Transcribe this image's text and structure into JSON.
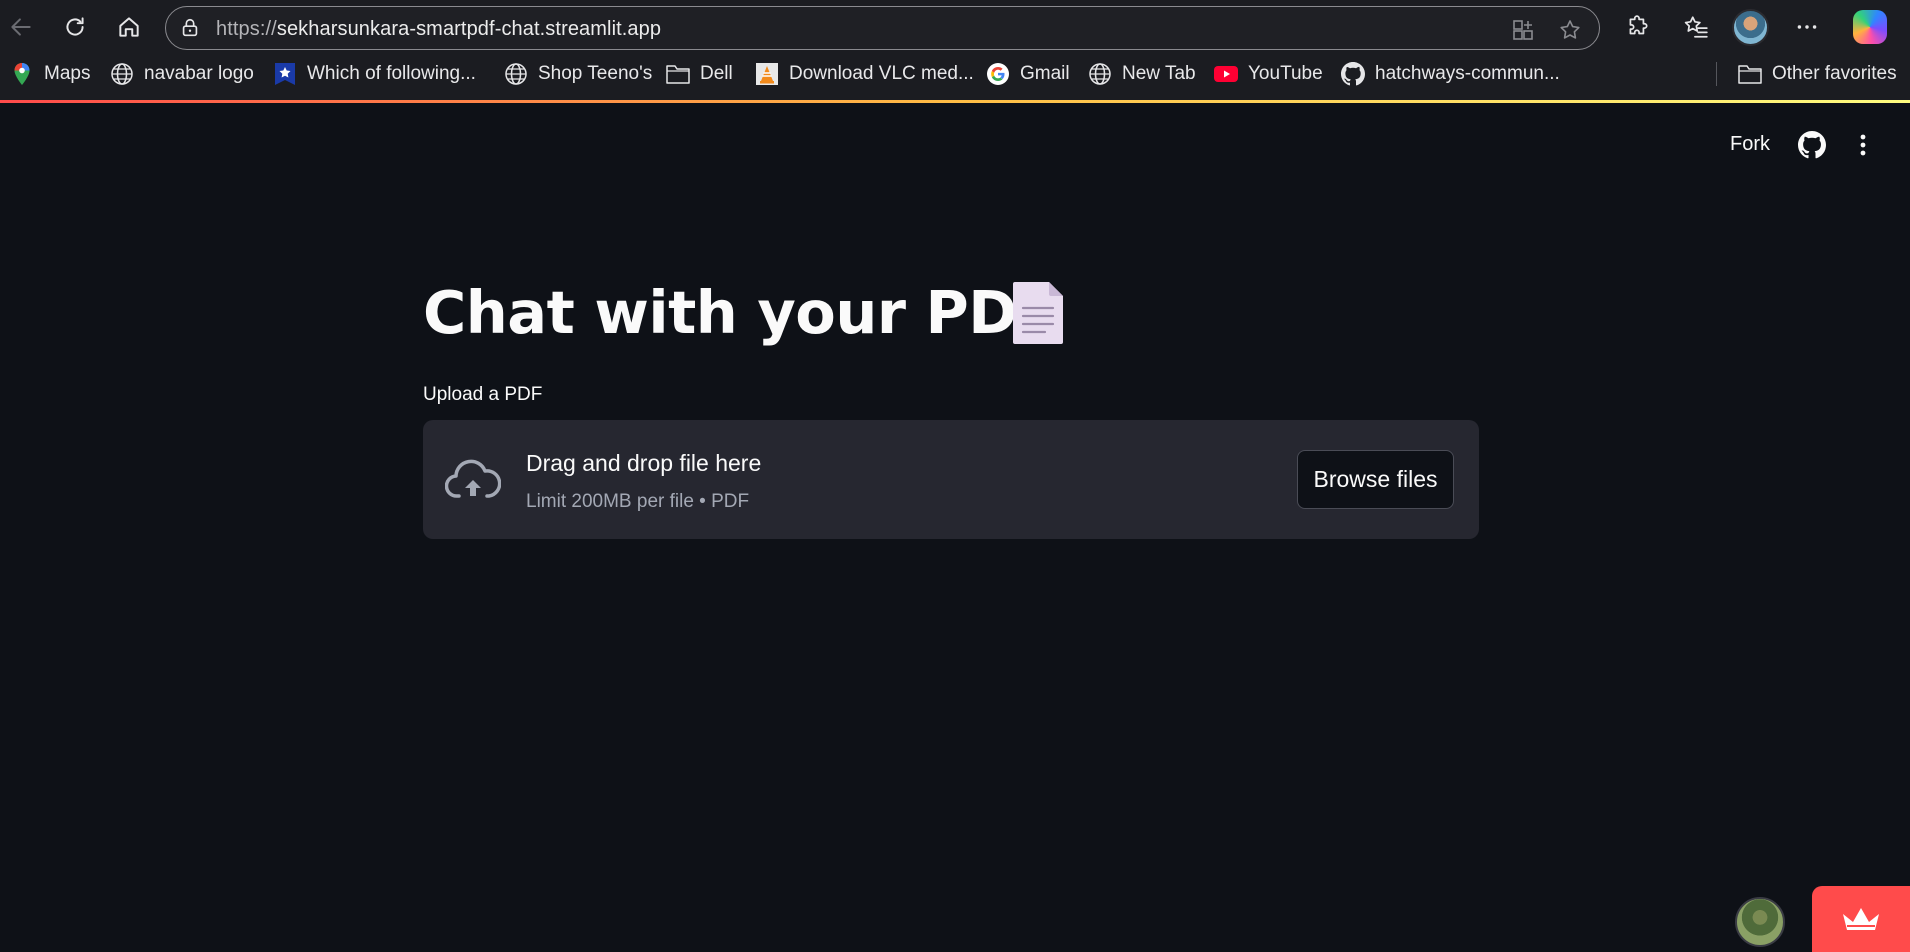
{
  "browser": {
    "url_scheme": "https://",
    "url_host": "sekharsunkara-smartpdf-chat.streamlit.app",
    "bookmarks": [
      {
        "label": "Maps",
        "icon": "maps-pin-icon"
      },
      {
        "label": "navabar logo",
        "icon": "globe-icon"
      },
      {
        "label": "Which of following...",
        "icon": "star-badge-icon"
      },
      {
        "label": "Shop Teeno's",
        "icon": "globe-icon"
      },
      {
        "label": "Dell",
        "icon": "folder-icon"
      },
      {
        "label": "Download VLC med...",
        "icon": "vlc-icon"
      },
      {
        "label": "Gmail",
        "icon": "google-icon"
      },
      {
        "label": "New Tab",
        "icon": "globe-icon"
      },
      {
        "label": "YouTube",
        "icon": "youtube-icon"
      },
      {
        "label": "hatchways-commun...",
        "icon": "github-icon"
      }
    ],
    "other_favorites": "Other favorites"
  },
  "header": {
    "fork_label": "Fork"
  },
  "main": {
    "title": "Chat with your PDF",
    "title_emoji": "document-emoji",
    "upload_label": "Upload a PDF",
    "dropzone_title": "Drag and drop file here",
    "dropzone_subtitle": "Limit 200MB per file • PDF",
    "browse_label": "Browse files"
  },
  "colors": {
    "background": "#0e1117",
    "dropzone": "#262730",
    "accent": "#ff4b4b"
  }
}
